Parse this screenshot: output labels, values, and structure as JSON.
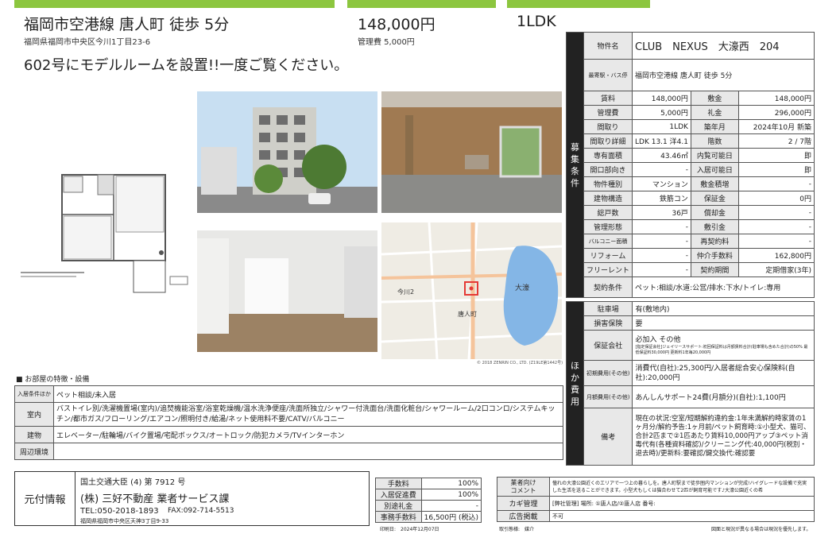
{
  "header": {
    "title": "福岡市空港線 唐人町 徒歩 5分",
    "address": "福岡県福岡市中央区今川1丁目23-6",
    "rent": "148,000円",
    "mgmt_fee": "管理費 5,000円",
    "layout": "1LDK",
    "headline": "602号にモデルルームを設置!!一度ご覧ください。"
  },
  "floorplan_note": "※図面と現況が異なる場合は現況を優先します。",
  "map_copyright": "© 2018 ZENRIN CO., LTD. (Z19LE第1442号)",
  "map_labels": {
    "station": "唐人町",
    "park": "大濠",
    "area": "今川2"
  },
  "colors": {
    "accent": "#8cc63f",
    "dark": "#222222"
  },
  "property": {
    "name_label": "物件名",
    "name": "CLUB　NEXUS　大濠西　204",
    "station_label": "最寄駅・バス停",
    "station": "福岡市空港線 唐人町 徒歩 5分",
    "side_label_1": "募集条件",
    "side_label_2": "ほか費用",
    "rows": [
      [
        "賃料",
        "148,000円",
        "敷金",
        "148,000円"
      ],
      [
        "管理費",
        "5,000円",
        "礼金",
        "296,000円"
      ],
      [
        "間取り",
        "1LDK",
        "築年月",
        "2024年10月 新築"
      ],
      [
        "間取り詳細",
        "LDK 13.1 洋4.1",
        "階数",
        "2 / 7階"
      ],
      [
        "専有面積",
        "43.46㎡",
        "内覧可能日",
        "即"
      ],
      [
        "開口部向き",
        "-",
        "入居可能日",
        "即"
      ],
      [
        "物件種別",
        "マンション",
        "敷金積増",
        "-"
      ],
      [
        "建物構造",
        "鉄筋コン",
        "保証金",
        "0円"
      ],
      [
        "総戸数",
        "36戸",
        "償却金",
        "-"
      ],
      [
        "管理形態",
        "-",
        "敷引金",
        "-"
      ],
      [
        "バルコニー面積",
        "-",
        "再契約料",
        "-"
      ],
      [
        "リフォーム",
        "-",
        "仲介手数料",
        "162,800円"
      ],
      [
        "フリーレント",
        "-",
        "契約期間",
        "定期借家(3年)"
      ]
    ],
    "contract_label": "契約条件",
    "contract": "ペット:相談/水道:公営/排水:下水/トイレ:専用",
    "other": [
      [
        "駐車場",
        "有(敷地内)"
      ],
      [
        "損害保険",
        "要"
      ],
      [
        "保証会社",
        "必加入 その他"
      ],
      [
        "初期費用(その他)",
        "消費代(自社):25,300円/入居者総合安心保険料(自社):20,000円"
      ],
      [
        "月額費用(その他)",
        "あんしんサポート24費(月額分)(自社):1,100円"
      ],
      [
        "備考",
        "現在の状況:空室/短期解約違約金:1年未満解約時家賃の1ヶ月分/解約予告:1ヶ月前/ペット飼育時:①小型犬、猫可、合計2匹まで②1匹あたり賃料10,000円アップ③ペット消毒代有(各種資料確認)/クリーニング代:40,000円(税別・退去時)/更新料:要確認/鍵交換代:確認要"
      ]
    ],
    "guarantor_note": "[指定保証会社]ジェイリースサポート:初回保証料は月額賃料合計(駐車場も含めた合計)の50% 最低保証料30,000円 更新料1年毎20,000円"
  },
  "features": {
    "title": "■ お部屋の特徴・設備",
    "rows": [
      [
        "入居条件ほか",
        "ペット相談/未入居"
      ],
      [
        "室内",
        "バストイレ別/洗濯機置場(室内)/追焚機能浴室/浴室乾燥機/温水洗浄便座/洗面所独立/シャワー付洗面台/洗面化粧台/シャワールーム/2口コンロ/システムキッチン/都市ガス/フローリング/エアコン/照明付き/給湯/ネット使用料不要/CATV/バルコニー"
      ],
      [
        "建物",
        "エレベーター/駐輪場/バイク置場/宅配ボックス/オートロック/防犯カメラ/TVインターホン"
      ],
      [
        "周辺環境",
        ""
      ]
    ]
  },
  "agent": {
    "label": "元付情報",
    "license": "国土交通大臣 (4) 第 7912 号",
    "company": "(株) 三好不動産 業者サービス課",
    "tel": "TEL:050-2018-1893",
    "fax": "FAX:092-714-5513",
    "address": "福岡県福岡市中央区天神3丁目9-33"
  },
  "fees": [
    [
      "手数料",
      "100%"
    ],
    [
      "入居促進費",
      "100%"
    ],
    [
      "別途礼金",
      "-"
    ],
    [
      "事務手数料",
      "16,500円 (税込)"
    ]
  ],
  "notes": {
    "comment_label": "業者向け\nコメント",
    "comment": "憧れの大濠公園近くのエリアで一つ上の暮らしを。唐人町駅まで徒歩圏内マンションが完成!ハイグレードな設備で充実した生活を送ることができます。小型犬もしくは猫合わせて2匹が飼育可能です♪大濠公園近くの希",
    "key_label": "カギ管理",
    "key": "[弊社管理] 場所: ①唐人店/②唐人店 番号:",
    "ad_label": "広告掲載",
    "ad": "不可"
  },
  "footer": {
    "print_date": "印刷日:　2024年12月07日",
    "mode": "取引態様:　媒介",
    "disclaimer": "図面と現況が異なる場合は現況を優先します。"
  }
}
